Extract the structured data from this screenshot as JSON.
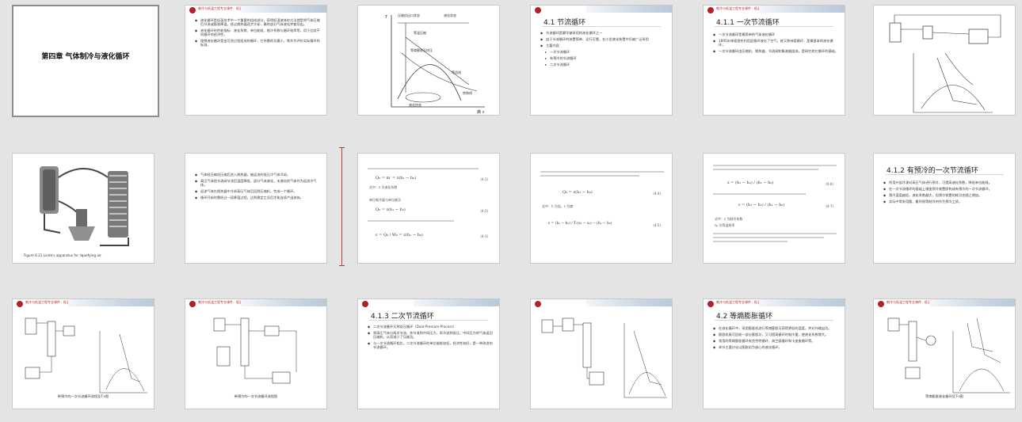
{
  "header_text": "制冷与低温工程专业课件 · 低温原理",
  "slides": {
    "s1": {
      "title": "第四章  气体制冷与液化循环"
    },
    "s2": {
      "bullets": [
        "液化循环是低温技术中一个重要的组成部分，获得低温液体的方法就是将气体压缩后节流或膨胀降温，经过换热器逐步冷却，最终部分气体液化并被导出。",
        "液化循环的性能指标：液化系数、单位能耗、制冷系数与循环效率等，用于比较不同循环的经济性。",
        "理想液化循环是由可逆过程组成的循环，它所需的功最小，常作为评价实际循环的标准。"
      ]
    },
    "s3": {
      "labels": [
        "压缩机出口状态",
        "液化状态",
        "等温压缩",
        "等熵膨胀至终压",
        "等焓线",
        "饱和线",
        "液化终态"
      ],
      "axis_x": "熵 s",
      "axis_y": "T"
    },
    "s4": {
      "title": "4.1 节流循环",
      "bullets": [
        "节流循环是最早被采用的液化循环之一",
        "由于节流循环的装置简单、运行可靠，在小型液化装置中仍被广泛采用",
        "主要内容"
      ],
      "subs": [
        "一次节流循环",
        "有预冷的节流循环",
        "二次节流循环"
      ]
    },
    "s5": {
      "title": "4.1.1 一次节流循环",
      "bullets": [
        "一次节流循环是最简单的气体液化循环",
        "1895年林德首先利用此循环液化了空气，故又称林德循环，是最基本的液化循环。",
        "一次节流循环由压缩机、换热器、节流阀和集液器组成，是研究其它循环的基础。"
      ]
    },
    "s7": {
      "figure_caption": "Figure 6.21  Linde's apparatus for liquefying air."
    },
    "s8": {
      "bullets": [
        "气体经压缩机压缩后进入换热器，被返流的低压冷气体冷却。",
        "高压气体经节流阀节流后温度降低，部分气体液化，未液化的气体作为返流冷气体。",
        "返流气体在换热器中冷却高压气体后回到压缩机，完成一个循环。",
        "循环开始时需经过一段降温过程，达到稳定工况后才能连续产出液体。"
      ]
    },
    "s9": {
      "eq1": "Q₀ = m′ = z(h₁ − h₀)",
      "eq1_no": "(4-1)",
      "eq2": "Q₀ = z(h₁ − h₂)",
      "eq2_no": "(4-2)",
      "eq3": "ε = Q₀ / W₀ = z(h₁ − h₀)",
      "eq3_no": "(4-3)",
      "notes": [
        "式中：z 为液化系数",
        "单位制冷量与单位耗功"
      ]
    },
    "s10": {
      "eq1": "Q₀ = z(h₁ − h₀)",
      "eq1_no": "(4-4)",
      "eq2": "ε = (h₁ − h₂) / T₁(s₁ − s₂) − (h₁ − h₂)",
      "eq2_no": "(4-5)",
      "notes": [
        "式中：h 为焓，s 为熵"
      ]
    },
    "s11": {
      "eq1": "z = (h₁ − h₂) / (h₁ − h₀)",
      "eq1_no": "(4-6)",
      "eq2": "ε = (h₁ − h₂) / (h₁ − h₀)",
      "eq2_no": "(4-7)",
      "notes": [
        "式中：ε 为制冷系数",
        "η₀ 为等温效率"
      ]
    },
    "s12": {
      "title": "4.1.2 有预冷的一次节流循环",
      "bullets": [
        "利用外部冷源对高压气体进行预冷，可提高液化系数，降低单位能耗。",
        "在一次节流循环的基础上增加预冷装置即构成有预冷的一次节流循环。",
        "预冷温度越低，液化系数越大，但预冷装置的耗功也随之增加。",
        "实际中常采用氨、氟利昂等制冷剂作为预冷工质。"
      ]
    },
    "s13": {
      "caption": "带预冷的一次节流循环流程及T-s图"
    },
    "s14": {
      "caption": "带预冷的一次节流循环流程图"
    },
    "s15": {
      "title": "4.1.3 二次节流循环",
      "bullets": [
        "二次节流循环又称双压循环（Dual-Pressure Process）",
        "将高压气体分两次节流，先节流到中间压力，再节流到低压，中间压力的气体返回压缩机，从而减少了压缩功。",
        "与一次节流循环相比，二次节流循环的单位能耗较低，经济性较好，是一种改进的节流循环。"
      ]
    },
    "s17": {
      "title": "4.2 等熵膨胀循环",
      "bullets": [
        "在液化循环中，采用膨胀机进行等熵膨胀可获得更低的温度，并对外输出功。",
        "膨胀机既可回收一部分膨胀功，又可提高循环的制冷量，使液化系数增大。",
        "常用的等熵膨胀循环有克劳特循环、海兰德循环和卡皮查循环等。",
        "本节主要讨论以膨胀机为核心的液化循环。"
      ]
    },
    "s18": {
      "caption": "等熵膨胀液化循环及T-s图"
    }
  }
}
